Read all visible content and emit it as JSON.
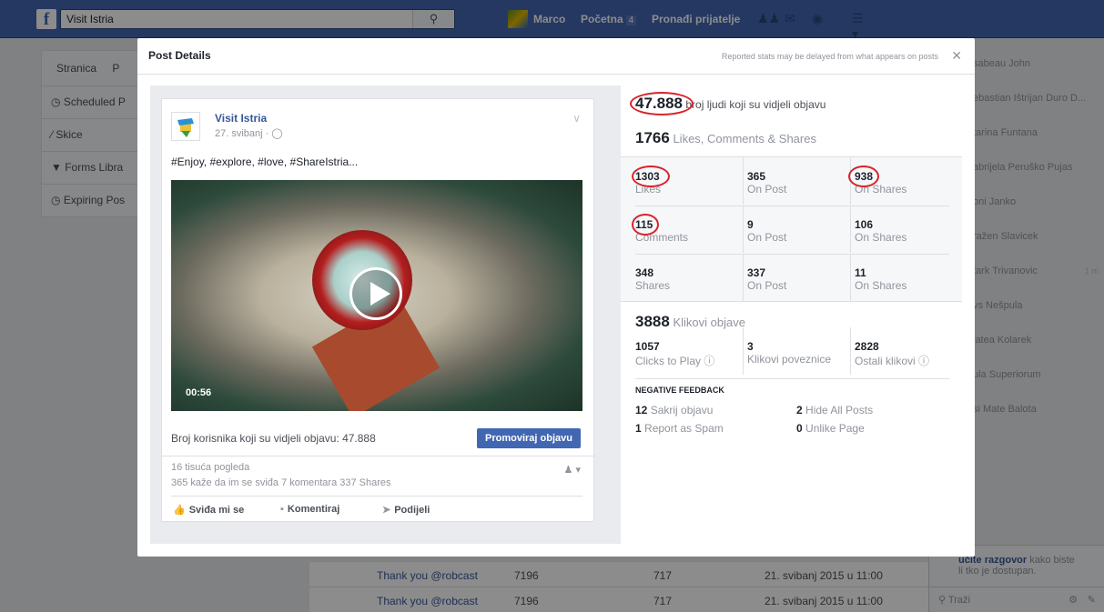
{
  "topbar": {
    "search_value": "Visit Istria",
    "user": "Marco",
    "home": "Početna",
    "home_badge": "4",
    "find_friends": "Pronađi prijatelje"
  },
  "leftpanel": {
    "tabs": [
      "Stranica",
      "P"
    ],
    "items": [
      {
        "label": "Scheduled P",
        "icon": "clock-icon"
      },
      {
        "label": "Skice",
        "icon": "pencil-icon"
      },
      {
        "label": "Forms Libra",
        "icon": "filter-icon"
      },
      {
        "label": "Expiring Pos",
        "icon": "clock-icon"
      }
    ]
  },
  "chat": {
    "contacts": [
      "sabeau John",
      "ebastian Ištrijan Duro D...",
      "tarina Funtana",
      "abrijela Peruško Pujas",
      "oni Janko",
      "ražen Slavicek",
      "tark Trivanovic",
      "vs Nešpula",
      "latea Kolarek",
      "ula Superiorum",
      "si Mate Balota"
    ],
    "footer_link": "učite razgovor",
    "footer_text": "kako biste",
    "footer_text2": "li tko je dostupan.",
    "search_label": "Traži",
    "status": "1 m"
  },
  "bg_rows": [
    {
      "title": "Thank you @robcast",
      "a": "7196",
      "b": "717",
      "date": "21. svibanj 2015 u 11:00"
    },
    {
      "title": "Thank you @robcast",
      "a": "7196",
      "b": "717",
      "date": "21. svibanj 2015 u 11:00"
    }
  ],
  "modal": {
    "title": "Post Details",
    "note": "Reported stats may be delayed from what appears on posts",
    "post": {
      "page_name": "Visit Istria",
      "date": "27. svibanj ·",
      "text": "#Enjoy, #explore, #love, #ShareIstria...",
      "video_duration": "00:56",
      "reach_line": "Broj korisnika koji su vidjeli objavu: 47.888",
      "promote_label": "Promoviraj objavu",
      "views": "16 tisuća pogleda",
      "engagement": "365 kaže da im se sviđa  7 komentara  337 Shares",
      "actions": {
        "like": "Sviđa mi se",
        "comment": "Komentiraj",
        "share": "Podijeli"
      }
    },
    "stats": {
      "reach_value": "47.888",
      "reach_label": "broj ljudi koji su vidjeli objavu",
      "lcs_value": "1766",
      "lcs_label": "Likes, Comments & Shares",
      "grid": [
        [
          {
            "n": "1303",
            "l": "Likes"
          },
          {
            "n": "365",
            "l": "On Post"
          },
          {
            "n": "938",
            "l": "On Shares"
          }
        ],
        [
          {
            "n": "115",
            "l": "Comments"
          },
          {
            "n": "9",
            "l": "On Post"
          },
          {
            "n": "106",
            "l": "On Shares"
          }
        ],
        [
          {
            "n": "348",
            "l": "Shares"
          },
          {
            "n": "337",
            "l": "On Post"
          },
          {
            "n": "11",
            "l": "On Shares"
          }
        ]
      ],
      "clicks_value": "3888",
      "clicks_label": "Klikovi objave",
      "clicks_grid": [
        {
          "n": "1057",
          "l": "Clicks to Play"
        },
        {
          "n": "3",
          "l": "Klikovi poveznice"
        },
        {
          "n": "2828",
          "l": "Ostali klikovi"
        }
      ],
      "negative_title": "NEGATIVE FEEDBACK",
      "negative": [
        {
          "n": "12",
          "l": "Sakrij objavu"
        },
        {
          "n": "2",
          "l": "Hide All Posts"
        },
        {
          "n": "1",
          "l": "Report as Spam"
        },
        {
          "n": "0",
          "l": "Unlike Page"
        }
      ]
    }
  },
  "colors": {
    "brand": "#4267b2",
    "highlight": "#d8232a",
    "link": "#365899"
  }
}
